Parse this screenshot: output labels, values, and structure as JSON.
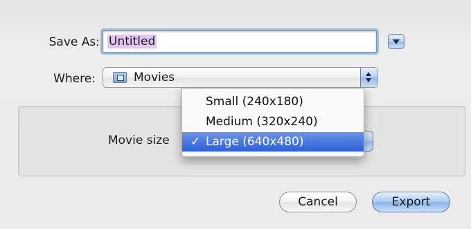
{
  "save_dialog": {
    "save_as_label": "Save As:",
    "filename_value": "Untitled",
    "where_label": "Where:",
    "where_value": "Movies",
    "movie_size_label": "Movie size",
    "menu_items": [
      {
        "label": "Small (240x180)",
        "checked": false
      },
      {
        "label": "Medium (320x240)",
        "checked": false
      },
      {
        "label": "Large (640x480)",
        "checked": true
      }
    ],
    "check_glyph": "✓",
    "cancel_label": "Cancel",
    "export_label": "Export"
  },
  "icons": {
    "where_folder": "folder-icon",
    "expand": "chevron-down-icon",
    "popup_arrows": "up-down-arrows-icon"
  },
  "colors": {
    "accent_blue": "#2c5fd9",
    "selection_highlight": "#e3c7f3",
    "focus_ring": "#9cbde6"
  }
}
